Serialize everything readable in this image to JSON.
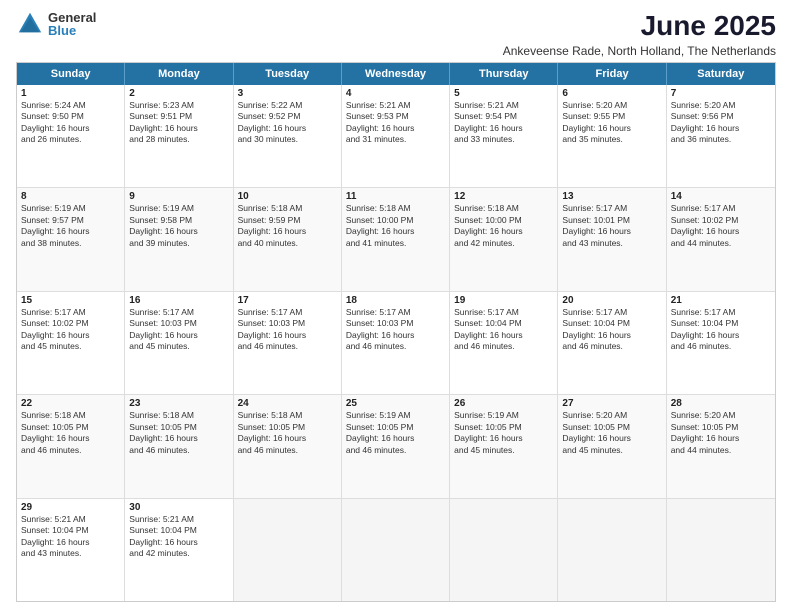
{
  "logo": {
    "general": "General",
    "blue": "Blue"
  },
  "title": "June 2025",
  "subtitle": "Ankeveense Rade, North Holland, The Netherlands",
  "header": {
    "days": [
      "Sunday",
      "Monday",
      "Tuesday",
      "Wednesday",
      "Thursday",
      "Friday",
      "Saturday"
    ]
  },
  "rows": [
    [
      {
        "day": "1",
        "lines": [
          "Sunrise: 5:24 AM",
          "Sunset: 9:50 PM",
          "Daylight: 16 hours",
          "and 26 minutes."
        ]
      },
      {
        "day": "2",
        "lines": [
          "Sunrise: 5:23 AM",
          "Sunset: 9:51 PM",
          "Daylight: 16 hours",
          "and 28 minutes."
        ]
      },
      {
        "day": "3",
        "lines": [
          "Sunrise: 5:22 AM",
          "Sunset: 9:52 PM",
          "Daylight: 16 hours",
          "and 30 minutes."
        ]
      },
      {
        "day": "4",
        "lines": [
          "Sunrise: 5:21 AM",
          "Sunset: 9:53 PM",
          "Daylight: 16 hours",
          "and 31 minutes."
        ]
      },
      {
        "day": "5",
        "lines": [
          "Sunrise: 5:21 AM",
          "Sunset: 9:54 PM",
          "Daylight: 16 hours",
          "and 33 minutes."
        ]
      },
      {
        "day": "6",
        "lines": [
          "Sunrise: 5:20 AM",
          "Sunset: 9:55 PM",
          "Daylight: 16 hours",
          "and 35 minutes."
        ]
      },
      {
        "day": "7",
        "lines": [
          "Sunrise: 5:20 AM",
          "Sunset: 9:56 PM",
          "Daylight: 16 hours",
          "and 36 minutes."
        ]
      }
    ],
    [
      {
        "day": "8",
        "lines": [
          "Sunrise: 5:19 AM",
          "Sunset: 9:57 PM",
          "Daylight: 16 hours",
          "and 38 minutes."
        ]
      },
      {
        "day": "9",
        "lines": [
          "Sunrise: 5:19 AM",
          "Sunset: 9:58 PM",
          "Daylight: 16 hours",
          "and 39 minutes."
        ]
      },
      {
        "day": "10",
        "lines": [
          "Sunrise: 5:18 AM",
          "Sunset: 9:59 PM",
          "Daylight: 16 hours",
          "and 40 minutes."
        ]
      },
      {
        "day": "11",
        "lines": [
          "Sunrise: 5:18 AM",
          "Sunset: 10:00 PM",
          "Daylight: 16 hours",
          "and 41 minutes."
        ]
      },
      {
        "day": "12",
        "lines": [
          "Sunrise: 5:18 AM",
          "Sunset: 10:00 PM",
          "Daylight: 16 hours",
          "and 42 minutes."
        ]
      },
      {
        "day": "13",
        "lines": [
          "Sunrise: 5:17 AM",
          "Sunset: 10:01 PM",
          "Daylight: 16 hours",
          "and 43 minutes."
        ]
      },
      {
        "day": "14",
        "lines": [
          "Sunrise: 5:17 AM",
          "Sunset: 10:02 PM",
          "Daylight: 16 hours",
          "and 44 minutes."
        ]
      }
    ],
    [
      {
        "day": "15",
        "lines": [
          "Sunrise: 5:17 AM",
          "Sunset: 10:02 PM",
          "Daylight: 16 hours",
          "and 45 minutes."
        ]
      },
      {
        "day": "16",
        "lines": [
          "Sunrise: 5:17 AM",
          "Sunset: 10:03 PM",
          "Daylight: 16 hours",
          "and 45 minutes."
        ]
      },
      {
        "day": "17",
        "lines": [
          "Sunrise: 5:17 AM",
          "Sunset: 10:03 PM",
          "Daylight: 16 hours",
          "and 46 minutes."
        ]
      },
      {
        "day": "18",
        "lines": [
          "Sunrise: 5:17 AM",
          "Sunset: 10:03 PM",
          "Daylight: 16 hours",
          "and 46 minutes."
        ]
      },
      {
        "day": "19",
        "lines": [
          "Sunrise: 5:17 AM",
          "Sunset: 10:04 PM",
          "Daylight: 16 hours",
          "and 46 minutes."
        ]
      },
      {
        "day": "20",
        "lines": [
          "Sunrise: 5:17 AM",
          "Sunset: 10:04 PM",
          "Daylight: 16 hours",
          "and 46 minutes."
        ]
      },
      {
        "day": "21",
        "lines": [
          "Sunrise: 5:17 AM",
          "Sunset: 10:04 PM",
          "Daylight: 16 hours",
          "and 46 minutes."
        ]
      }
    ],
    [
      {
        "day": "22",
        "lines": [
          "Sunrise: 5:18 AM",
          "Sunset: 10:05 PM",
          "Daylight: 16 hours",
          "and 46 minutes."
        ]
      },
      {
        "day": "23",
        "lines": [
          "Sunrise: 5:18 AM",
          "Sunset: 10:05 PM",
          "Daylight: 16 hours",
          "and 46 minutes."
        ]
      },
      {
        "day": "24",
        "lines": [
          "Sunrise: 5:18 AM",
          "Sunset: 10:05 PM",
          "Daylight: 16 hours",
          "and 46 minutes."
        ]
      },
      {
        "day": "25",
        "lines": [
          "Sunrise: 5:19 AM",
          "Sunset: 10:05 PM",
          "Daylight: 16 hours",
          "and 46 minutes."
        ]
      },
      {
        "day": "26",
        "lines": [
          "Sunrise: 5:19 AM",
          "Sunset: 10:05 PM",
          "Daylight: 16 hours",
          "and 45 minutes."
        ]
      },
      {
        "day": "27",
        "lines": [
          "Sunrise: 5:20 AM",
          "Sunset: 10:05 PM",
          "Daylight: 16 hours",
          "and 45 minutes."
        ]
      },
      {
        "day": "28",
        "lines": [
          "Sunrise: 5:20 AM",
          "Sunset: 10:05 PM",
          "Daylight: 16 hours",
          "and 44 minutes."
        ]
      }
    ],
    [
      {
        "day": "29",
        "lines": [
          "Sunrise: 5:21 AM",
          "Sunset: 10:04 PM",
          "Daylight: 16 hours",
          "and 43 minutes."
        ]
      },
      {
        "day": "30",
        "lines": [
          "Sunrise: 5:21 AM",
          "Sunset: 10:04 PM",
          "Daylight: 16 hours",
          "and 42 minutes."
        ]
      },
      {
        "day": "",
        "lines": []
      },
      {
        "day": "",
        "lines": []
      },
      {
        "day": "",
        "lines": []
      },
      {
        "day": "",
        "lines": []
      },
      {
        "day": "",
        "lines": []
      }
    ]
  ]
}
